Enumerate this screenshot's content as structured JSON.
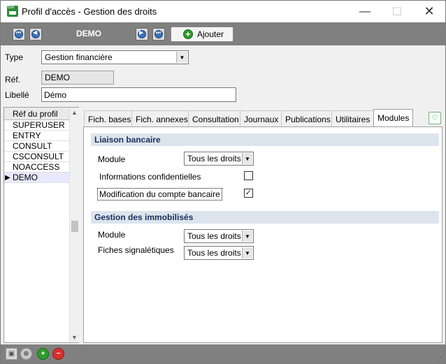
{
  "window": {
    "title": "Profil d'accès - Gestion des droits",
    "app_icon_text": "EBP",
    "minimize": "—",
    "maximize": "☐",
    "close": "✕"
  },
  "toolbar": {
    "record_title": "DEMO",
    "add_label": "Ajouter"
  },
  "form": {
    "type_label": "Type",
    "type_value": "Gestion financière",
    "ref_label": "Réf.",
    "ref_value": "DEMO",
    "libelle_label": "Libellé",
    "libelle_value": "Démo"
  },
  "profile_list": {
    "header": "Réf du profil",
    "items": [
      "SUPERUSER",
      "ENTRY",
      "CONSULT",
      "CSCONSULT",
      "NOACCESS",
      "DEMO"
    ],
    "selected": "DEMO"
  },
  "tabs": [
    "Fich. bases",
    "Fich. annexes",
    "Consultation",
    "Journaux",
    "Publications",
    "Utilitaires",
    "Modules"
  ],
  "active_tab": "Modules",
  "sections": {
    "liaison": {
      "title": "Liaison bancaire",
      "module_label": "Module",
      "module_value": "Tous les droits",
      "info_conf_label": "Informations confidentielles",
      "info_conf_checked": false,
      "modif_compte_label": "Modification du compte bancaire",
      "modif_compte_checked": true
    },
    "immobilises": {
      "title": "Gestion des immobilisés",
      "module_label": "Module",
      "module_value": "Tous les droits",
      "fiches_label": "Fiches signalétiques",
      "fiches_value": "Tous les droits"
    }
  },
  "colors": {
    "toolbar_bg": "#808080",
    "section_bg": "#dce4ee",
    "section_text": "#1a2f5a",
    "add_green": "#2e9a2e",
    "delete_red": "#d93030"
  }
}
